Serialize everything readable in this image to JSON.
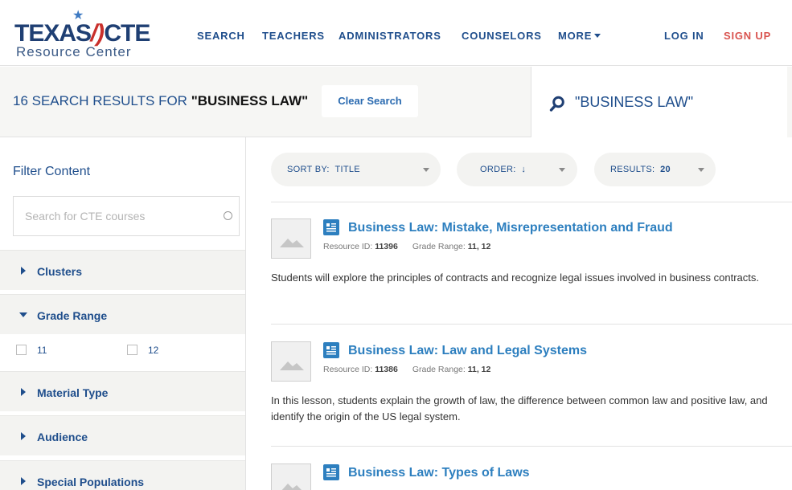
{
  "logo": {
    "brand_left": "TEXAS",
    "brand_right": "CTE",
    "subtitle": "Resource Center"
  },
  "nav": {
    "search": "SEARCH",
    "teachers": "TEACHERS",
    "administrators": "ADMINISTRATORS",
    "counselors": "COUNSELORS",
    "more": "MORE",
    "login": "LOG IN",
    "signup": "SIGN UP"
  },
  "search_bar": {
    "results_prefix": "16 SEARCH RESULTS FOR ",
    "results_query": "\"BUSINESS LAW\"",
    "clear_label": "Clear Search",
    "query_display": "\"BUSINESS LAW\""
  },
  "sidebar": {
    "filter_title": "Filter Content",
    "course_search_placeholder": "Search for CTE courses",
    "facets": {
      "clusters": "Clusters",
      "grade_range": "Grade Range",
      "material_type": "Material Type",
      "audience": "Audience",
      "special_populations": "Special Populations"
    },
    "grade_options": [
      "11",
      "12"
    ]
  },
  "sort": {
    "sort_by_label": "SORT BY:",
    "sort_by_value": "TITLE",
    "order_label": "ORDER:",
    "order_value": "↓",
    "results_label": "RESULTS:",
    "results_value": "20"
  },
  "results": [
    {
      "title": "Business Law: Mistake, Misrepresentation and Fraud",
      "id_label": "Resource ID:",
      "id": "11396",
      "grade_label": "Grade Range:",
      "grade": "11, 12",
      "description": "Students will explore the principles of contracts and recognize legal issues involved in business contracts."
    },
    {
      "title": "Business Law: Law and Legal Systems",
      "id_label": "Resource ID:",
      "id": "11386",
      "grade_label": "Grade Range:",
      "grade": "11, 12",
      "description": "In this lesson, students explain the growth of law, the difference between common law and positive law, and identify the origin of the US legal system."
    },
    {
      "title": "Business Law: Types of Laws"
    }
  ],
  "colors": {
    "brand_blue": "#1f4e8c",
    "link_blue": "#2d7fbf",
    "signup_red": "#d9534f",
    "panel_gray": "#f3f3f1"
  }
}
